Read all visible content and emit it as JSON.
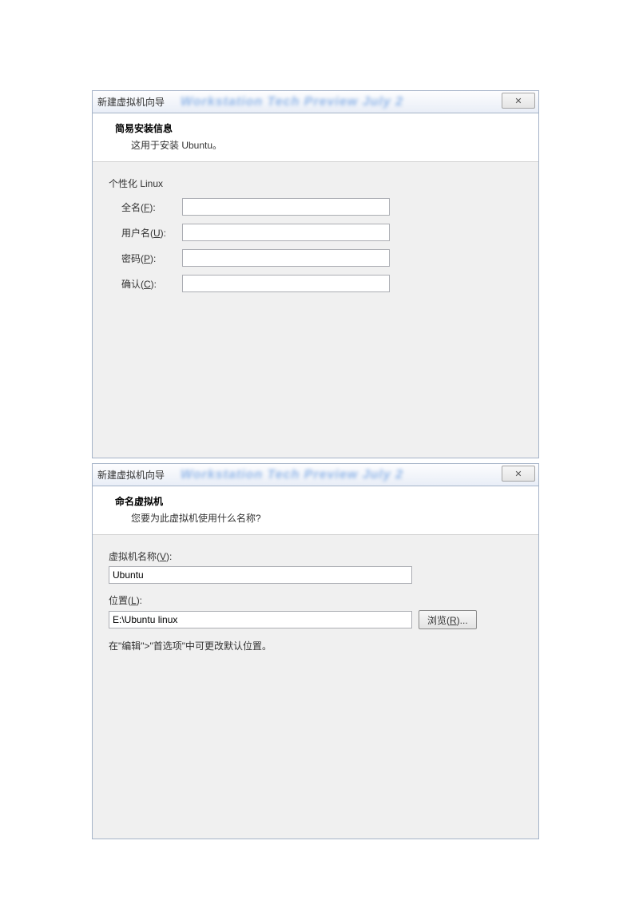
{
  "dialog1": {
    "title": "新建虚拟机向导",
    "blur_text": "Workstation Tech Preview July 2",
    "close": "✕",
    "header_title": "简易安装信息",
    "header_desc": "这用于安装 Ubuntu。",
    "section_label": "个性化 Linux",
    "fields": {
      "fullname_label_pre": "全名(",
      "fullname_accel": "F",
      "fullname_label_post": "):",
      "fullname_value": "",
      "username_label_pre": "用户名(",
      "username_accel": "U",
      "username_label_post": "):",
      "username_value": "",
      "password_label_pre": "密码(",
      "password_accel": "P",
      "password_label_post": "):",
      "password_value": "",
      "confirm_label_pre": "确认(",
      "confirm_accel": "C",
      "confirm_label_post": "):",
      "confirm_value": ""
    }
  },
  "dialog2": {
    "title": "新建虚拟机向导",
    "blur_text": "Workstation Tech Preview July 2",
    "close": "✕",
    "header_title": "命名虚拟机",
    "header_desc": "您要为此虚拟机使用什么名称?",
    "vmname_label_pre": "虚拟机名称(",
    "vmname_accel": "V",
    "vmname_label_post": "):",
    "vmname_value": "Ubuntu",
    "location_label_pre": "位置(",
    "location_accel": "L",
    "location_label_post": "):",
    "location_value": "E:\\Ubuntu linux",
    "browse_label_pre": "浏览(",
    "browse_accel": "R",
    "browse_label_post": ")...",
    "hint": "在\"编辑\">\"首选项\"中可更改默认位置。"
  }
}
